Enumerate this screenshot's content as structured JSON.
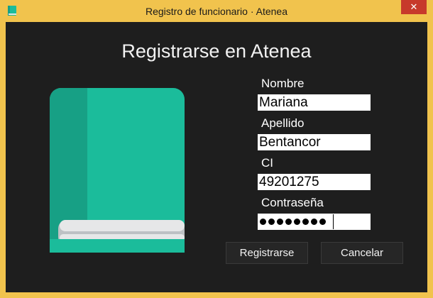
{
  "window": {
    "title": "Registro de funcionario · Atenea",
    "close_symbol": "✕",
    "icon": "book-icon"
  },
  "main": {
    "heading": "Registrarse en Atenea",
    "illustration": "book-icon"
  },
  "form": {
    "nombre_label": "Nombre",
    "nombre_value": "Mariana",
    "apellido_label": "Apellido",
    "apellido_value": "Bentancor",
    "ci_label": "CI",
    "ci_value": "49201275",
    "password_label": "Contraseña",
    "password_masked": "••••••••",
    "password_length": 8
  },
  "buttons": {
    "register_label": "Registrarse",
    "cancel_label": "Cancelar"
  },
  "colors": {
    "frame": "#f1c34d",
    "background": "#1e1e1e",
    "book_cover": "#1bbc9b",
    "book_spine": "#17a085",
    "close_button": "#c7392b"
  }
}
